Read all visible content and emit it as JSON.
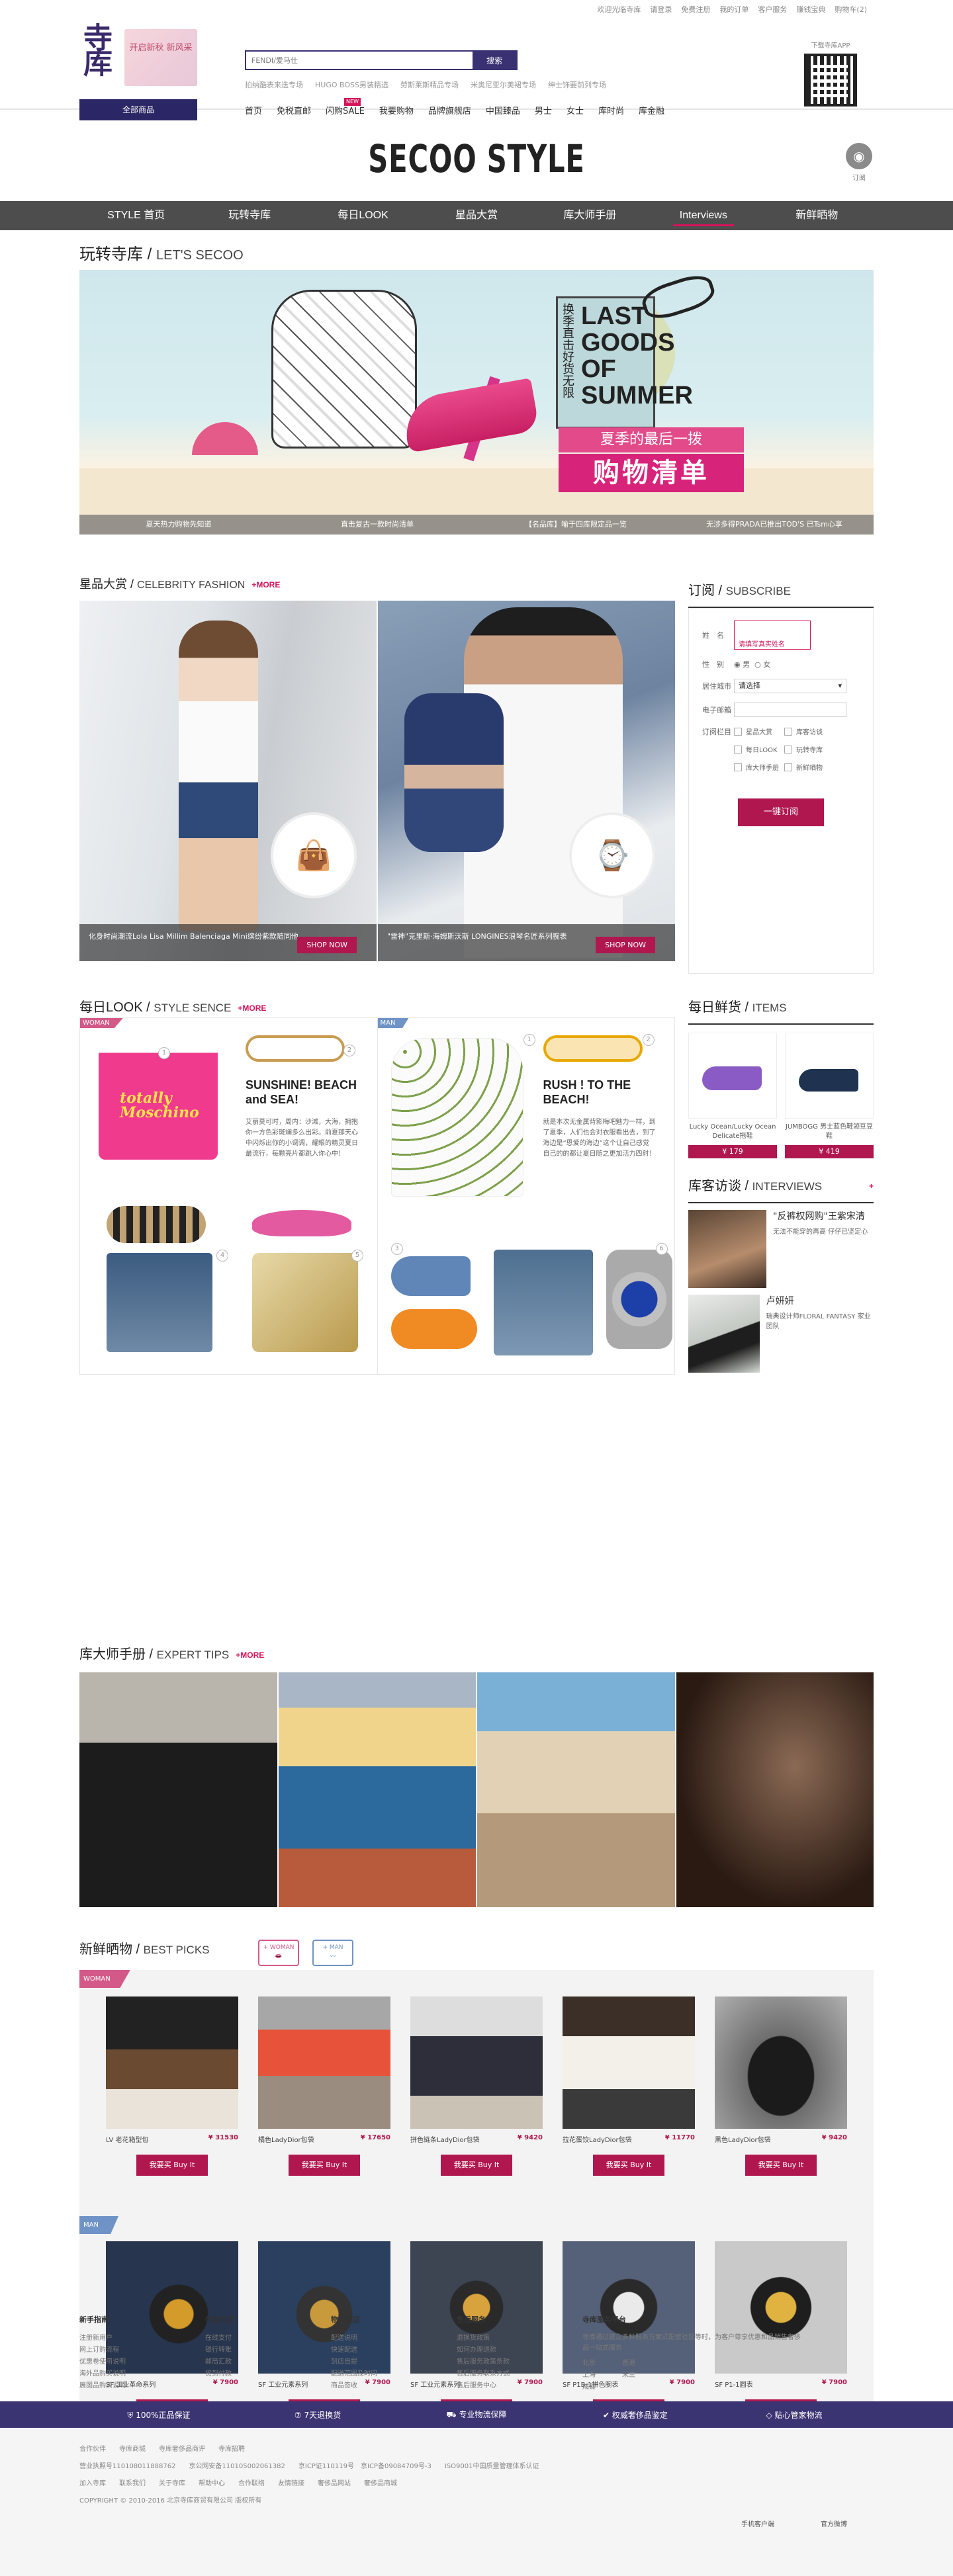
{
  "topbar": {
    "links": [
      "欢迎光临寺库",
      "请登录",
      "免费注册",
      "我的订单",
      "客户服务",
      "赚钱宝典",
      "购物车(2)"
    ]
  },
  "header": {
    "logo_text": "寺库",
    "promo_text": "开启新秋 新风采",
    "all_categories": "全部商品",
    "search_placeholder": "FENDI/爱马仕",
    "search_button": "搜索",
    "hot_words": [
      "拍纳酷表来迭专场",
      "HUGO BOSS男装精选",
      "劳斯莱斯精品专场",
      "米奥尼亚尔美裙专场",
      "绅士饰要前列专场"
    ],
    "qr_label": "下载寺库APP",
    "nav": [
      "首页",
      "免税直邮",
      "闪购SALE",
      "我要购物",
      "品牌旗舰店",
      "中国臻品",
      "男士",
      "女士",
      "库时尚",
      "库金融"
    ],
    "nav_new_badge": "NEW"
  },
  "style": {
    "title": "SECOO STYLE",
    "rss_label": "订阅",
    "nav": [
      "STYLE 首页",
      "玩转寺库",
      "每日LOOK",
      "星品大赏",
      "库大师手册",
      "Interviews",
      "新鲜晒物"
    ],
    "active_nav": "Interviews"
  },
  "section_lets_secoo": {
    "title_cn": "玩转寺库",
    "title_en": "LET'S SECOO",
    "hero": {
      "vertical_text": "换季直击好货无限",
      "headline": [
        "LAST",
        "GOODS",
        "OF",
        "SUMMER"
      ],
      "pink_line1": "夏季的最后一拨",
      "pink_line2": "购物清单",
      "captions": [
        "夏天热力购物先知道",
        "直击复古一款时尚清单",
        "【名品库】喻于四库限定品一览",
        "无涉多得PRADA已推出TOD'S 已Tsm心享"
      ]
    }
  },
  "section_celebrity": {
    "title_cn": "星品大赏",
    "title_en": "CELEBRITY FASHION",
    "more": "+MORE",
    "cards": [
      {
        "caption": "化身时尚潮流Lola Lisa Millim Balenciaga Mini缤纷紫款随同他",
        "shop": "SHOP NOW"
      },
      {
        "caption": "\"雷神\"克里斯·海姆斯沃斯 LONGINES浪琴名匠系列腕表",
        "shop": "SHOP NOW"
      }
    ]
  },
  "subscribe": {
    "title_cn": "订阅",
    "title_en": "SUBSCRIBE",
    "name_label": "姓　名",
    "name_hint": "请填写真实姓名",
    "gender_label": "性　别",
    "gender_options": [
      "男",
      "女"
    ],
    "city_label": "居住城市",
    "city_value": "请选择",
    "email_label": "电子邮箱",
    "channel_label": "订阅栏目",
    "channels": [
      "星品大赏",
      "库客访谈",
      "每日LOOK",
      "玩转寺库",
      "库大师手册",
      "新鲜晒物"
    ],
    "button": "一键订阅"
  },
  "section_daily_look": {
    "title_cn": "每日LOOK",
    "title_en": "STYLE SENCE",
    "more": "+MORE",
    "woman": {
      "tag": "WOMAN",
      "headline": "SUNSHINE! BEACH and SEA!",
      "body": "艾丽莫可时，周内：沙滩，大海，拥抱你一方色彩斑斓多么出彩。前夏那天心中闪烁出你的小调调，耀眼的精灵夏日最流行，每颗亮片都跳入你心中！"
    },
    "man": {
      "tag": "MAN",
      "headline": "RUSH ! TO THE BEACH!",
      "body": "就是本次无金属背影梅吧魅力一样，到了夏季，人们也会对衣服看出去，到了海边是“恩爱的海边”这个让自己感觉自己的的都让夏日随之更加活力四射！"
    }
  },
  "section_items": {
    "title_cn": "每日鲜货",
    "title_en": "ITEMS",
    "items": [
      {
        "name": "Lucky Ocean/Lucky Ocean Delicate拖鞋",
        "price": "¥ 179"
      },
      {
        "name": "JUMBOGG 男士蓝色鞋领豆豆鞋",
        "price": "¥ 419"
      }
    ]
  },
  "section_interviews": {
    "title_cn": "库客访谈",
    "title_en": "INTERVIEWS",
    "more": "+",
    "entries": [
      {
        "name": "\"反裤权网购\"王紫宋清",
        "desc": "无法不能穿的再高 仔仔已坚定心"
      },
      {
        "name": "卢妍妍",
        "desc": "瑞典设计师FLORAL FANTASY 家业团队"
      }
    ]
  },
  "section_expert_tips": {
    "title_cn": "库大师手册",
    "title_en": "EXPERT TIPS",
    "more": "+MORE"
  },
  "section_best_picks": {
    "title_cn": "新鲜晒物",
    "title_en": "BEST PICKS",
    "chip_woman": "+ WOMAN",
    "chip_man": "+ MAN",
    "woman_tag": "WOMAN",
    "man_tag": "MAN",
    "buy_label": "我要买 Buy It",
    "woman_items": [
      {
        "name": "LV 老花箱型包",
        "price": "¥ 31530"
      },
      {
        "name": "橘色LadyDior包袋",
        "price": "¥ 17650"
      },
      {
        "name": "拼色链条LadyDior包袋",
        "price": "¥ 9420"
      },
      {
        "name": "拉花蛋饺LadyDior包袋",
        "price": "¥ 11770"
      },
      {
        "name": "黑色LadyDior包袋",
        "price": "¥ 9420"
      }
    ],
    "man_items": [
      {
        "name": "SF 工业革命系列",
        "price": "¥ 7900"
      },
      {
        "name": "SF 工业元素系列",
        "price": "¥ 7900"
      },
      {
        "name": "SF 工业元素系列",
        "price": "¥ 7900"
      },
      {
        "name": "SF P1B-1拼色腕表",
        "price": "¥ 7900"
      },
      {
        "name": "SF P1-1圆表",
        "price": "¥ 7900"
      }
    ]
  },
  "footer": {
    "cols": [
      {
        "title": "新手指南",
        "links": [
          "注册新用户",
          "网上订购流程",
          "优惠卷使用说明",
          "海外品购买说明",
          "展图品购买说明"
        ]
      },
      {
        "title": "付款方式",
        "links": [
          "在线支付",
          "银行转账",
          "邮局汇款",
          "货到付款"
        ]
      },
      {
        "title": "物流配送",
        "links": [
          "配送说明",
          "快速配送",
          "到店自提",
          "配送范围及时间",
          "商品签收"
        ]
      },
      {
        "title": "售后服务",
        "links": [
          "退换货政策",
          "如何办理退款",
          "售后服务政策条款",
          "售后服务联系方式",
          "售后服务中心"
        ]
      }
    ],
    "about_title": "寺库服务平台",
    "about_text": "寺库通过建立多种服务方案式配套社区等时，为客户尊享优惠和品销售奢侈品一站式服务",
    "about_cities": [
      "北京",
      "上海",
      "成都",
      "香港",
      "米兰"
    ],
    "promises": [
      "100%正品保证",
      "7天退换货",
      "专业物流保障",
      "权威奢侈品鉴定",
      "贴心管家物流"
    ],
    "bottom_lines": [
      "合作伙伴　　寺库商城　　寺库奢侈品商评　　寺库招聘",
      "营业执照号110108011888762　　京公网安备110105002061382　　京ICP证110119号　京ICP备09084709号-3　　ISO9001中国质量管理体系认证",
      "加入寺库　　联系我们　　关于寺库　　帮助中心　　合作联络　　友情链接　　奢侈品网站　　奢侈品商城",
      "COPYRIGHT © 2010-2016 北京寺库商贸有限公司 版权所有"
    ],
    "bottom_right": [
      "手机客户端",
      "官方微博"
    ]
  }
}
